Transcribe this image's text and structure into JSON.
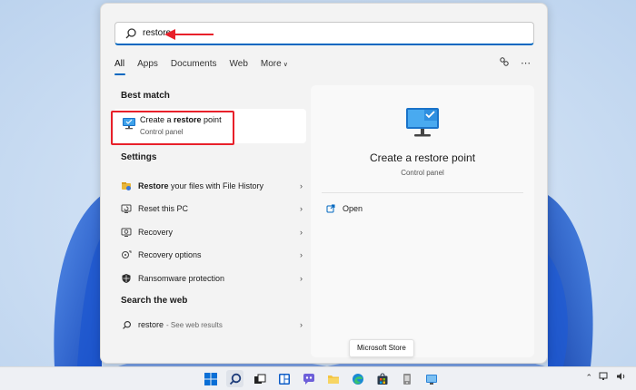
{
  "search": {
    "value": "restore",
    "icon": "search-icon"
  },
  "tabs": [
    {
      "label": "All",
      "active": true
    },
    {
      "label": "Apps"
    },
    {
      "label": "Documents"
    },
    {
      "label": "Web"
    },
    {
      "label": "More"
    }
  ],
  "sections": {
    "best_match": "Best match",
    "settings": "Settings",
    "search_web": "Search the web"
  },
  "best_match": {
    "title_prefix": "Create a ",
    "title_bold": "restore",
    "title_suffix": " point",
    "subtitle": "Control panel"
  },
  "settings_items": [
    {
      "bold": "Restore",
      "rest": " your files with File History",
      "icon": "file-history-icon"
    },
    {
      "bold": "",
      "rest": "Reset this PC",
      "icon": "reset-pc-icon"
    },
    {
      "bold": "",
      "rest": "Recovery",
      "icon": "recovery-icon"
    },
    {
      "bold": "",
      "rest": "Recovery options",
      "icon": "recovery-options-icon"
    },
    {
      "bold": "",
      "rest": "Ransomware protection",
      "icon": "shield-icon"
    }
  ],
  "web_result": {
    "query": "restore",
    "suffix": "- See web results"
  },
  "preview": {
    "title": "Create a restore point",
    "subtitle": "Control panel",
    "open_label": "Open"
  },
  "tooltip": "Microsoft Store",
  "colors": {
    "accent": "#0067c0",
    "annotation": "#e8202a"
  }
}
